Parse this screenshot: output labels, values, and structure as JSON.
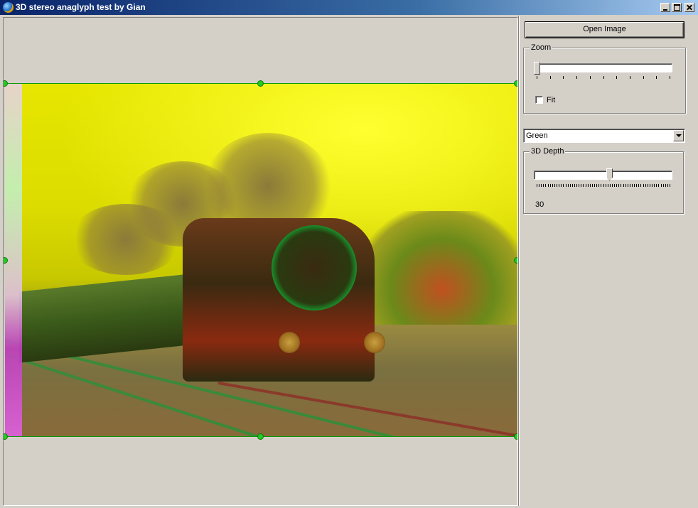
{
  "window": {
    "title": "3D stereo anaglyph test by Gian",
    "icon": "globe-icon"
  },
  "toolbar": {
    "open_image_label": "Open Image"
  },
  "zoom": {
    "group_label": "Zoom",
    "level": 0.0,
    "fit_label": "Fit",
    "fit_checked": false
  },
  "channel": {
    "selected": "Green"
  },
  "depth": {
    "group_label": "3D Depth",
    "level": 0.55,
    "value_text": "30"
  },
  "image": {
    "description_icon": "anaglyph-photo",
    "selection_color": "#22cc22"
  }
}
